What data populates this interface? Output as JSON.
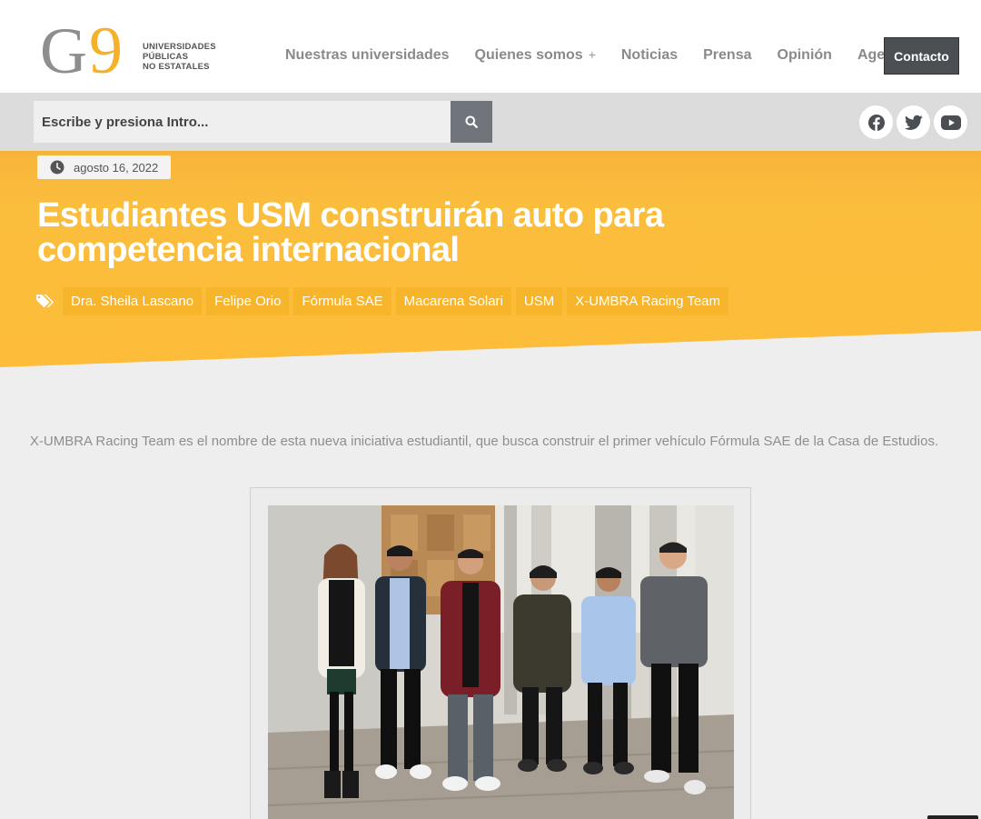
{
  "logo": {
    "mark": "G9",
    "line1": "UNIVERSIDADES",
    "line2": "PÚBLICAS",
    "line3": "NO ESTATALES"
  },
  "nav": {
    "items": [
      {
        "label": "Nuestras universidades"
      },
      {
        "label": "Quienes somos",
        "suffix": "+"
      },
      {
        "label": "Noticias"
      },
      {
        "label": "Prensa"
      },
      {
        "label": "Opinión"
      },
      {
        "label": "Agenda"
      }
    ],
    "contact": "Contacto"
  },
  "search": {
    "placeholder": "Escribe y presiona Intro..."
  },
  "social": [
    "facebook-icon",
    "twitter-icon",
    "youtube-icon"
  ],
  "post": {
    "date": "agosto 16, 2022",
    "title": "Estudiantes USM construirán auto para competencia internacional",
    "tags": [
      "Dra. Sheila Lascano",
      "Felipe Orio",
      "Fórmula SAE",
      "Macarena Solari",
      "USM",
      "X-UMBRA Racing Team"
    ],
    "lead": "X-UMBRA Racing Team es el nombre de esta nueva iniciativa estudiantil, que busca construir el primer vehículo Fórmula SAE de la Casa de Estudios."
  },
  "colors": {
    "brand_yellow": "#fbb93b",
    "tag_bg": "#f6b52b",
    "dark_button": "#4b4f54",
    "search_button": "#70757b"
  }
}
